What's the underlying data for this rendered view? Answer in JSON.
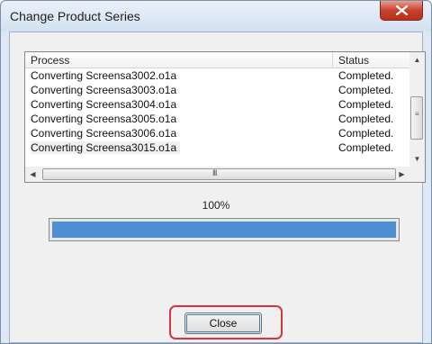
{
  "window": {
    "title": "Change Product Series"
  },
  "list": {
    "columns": [
      "Process",
      "Status"
    ],
    "rows": [
      {
        "process": "Converting Screensa3002.o1a",
        "status": "Completed."
      },
      {
        "process": "Converting Screensa3003.o1a",
        "status": "Completed."
      },
      {
        "process": "Converting Screensa3004.o1a",
        "status": "Completed."
      },
      {
        "process": "Converting Screensa3005.o1a",
        "status": "Completed."
      },
      {
        "process": "Converting Screensa3006.o1a",
        "status": "Completed."
      },
      {
        "process": "Converting Screensa3015.o1a",
        "status": "Completed."
      }
    ]
  },
  "progress": {
    "label": "100%",
    "value": 1.0,
    "color": "#4d8fd1"
  },
  "buttons": {
    "close_label": "Close"
  },
  "colors": {
    "highlight": "#d6343c",
    "title_close": "#c7412c"
  }
}
